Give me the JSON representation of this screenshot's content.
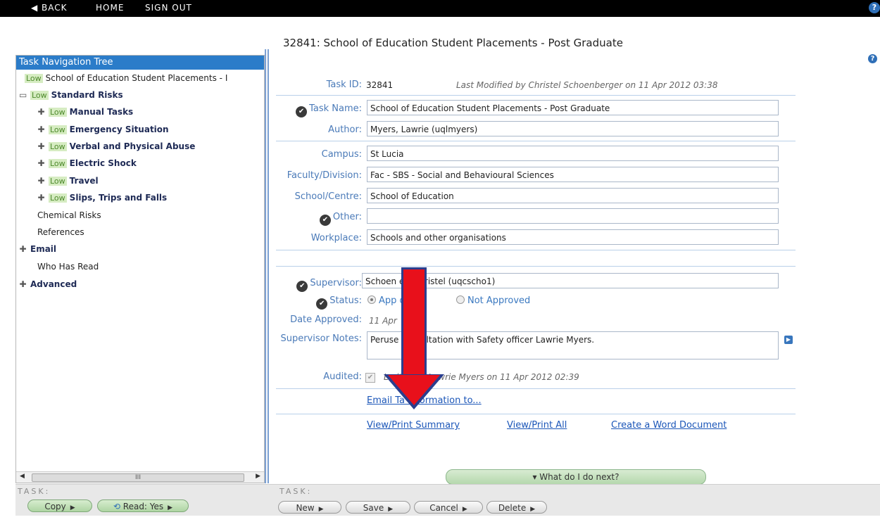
{
  "nav": {
    "back": "◀ BACK",
    "home": "HOME",
    "signout": "SIGN OUT",
    "help": "?"
  },
  "page_title": "32841: School of Education Student Placements - Post Graduate",
  "tree": {
    "header": "Task Navigation Tree",
    "low": "Low",
    "root": "School of Education Student Placements - I",
    "standard_risks": "Standard Risks",
    "risks": [
      "Manual Tasks",
      "Emergency Situation",
      "Verbal and Physical Abuse",
      "Electric Shock",
      "Travel",
      "Slips, Trips and Falls"
    ],
    "chemical": "Chemical Risks",
    "references": "References",
    "email": "Email",
    "who_read": "Who Has Read",
    "advanced": "Advanced",
    "minus": "▭",
    "plus": "✚",
    "scroll_mark": "III"
  },
  "form": {
    "task_id_label": "Task ID:",
    "task_id": "32841",
    "last_modified": "Last Modified by Christel Schoenberger on 11 Apr 2012 03:38",
    "task_name_label": "Task Name:",
    "task_name": "School of Education Student Placements - Post Graduate",
    "author_label": "Author:",
    "author": "Myers, Lawrie (uqlmyers)",
    "campus_label": "Campus:",
    "campus": "St Lucia",
    "faculty_label": "Faculty/Division:",
    "faculty": "Fac - SBS - Social and Behavioural Sciences",
    "school_label": "School/Centre:",
    "school": "School of Education",
    "other_label": "Other:",
    "other": "",
    "workplace_label": "Workplace:",
    "workplace": "Schools and other organisations",
    "supervisor_label": "Supervisor:",
    "supervisor": "Schoen     er, Christel (uqcscho1)",
    "status_label": "Status:",
    "status_approved": "App          d",
    "status_not_approved": "Not Approved",
    "date_label": "Date Approved:",
    "date_value": "11 Apr",
    "notes_label": "Supervisor Notes:",
    "notes": "Peruse       consultation with Safety officer Lawrie Myers.",
    "audited_label": "Audited:",
    "audited_text": "La              ited by Lawrie Myers on 11 Apr 2012 02:39",
    "email_link": "Email Ta   Information to...",
    "view_summary": "View/Print Summary",
    "view_all": "View/Print All",
    "create_word": "Create a Word Document",
    "next": "▾ What do I do next?",
    "tick": "✔",
    "expand": "▶"
  },
  "bottom": {
    "task_label": "TASK:",
    "copy": "Copy",
    "read": "Read: Yes",
    "new": "New",
    "save": "Save",
    "cancel": "Cancel",
    "delete": "Delete",
    "caret": "▶",
    "sync": "⟲"
  }
}
